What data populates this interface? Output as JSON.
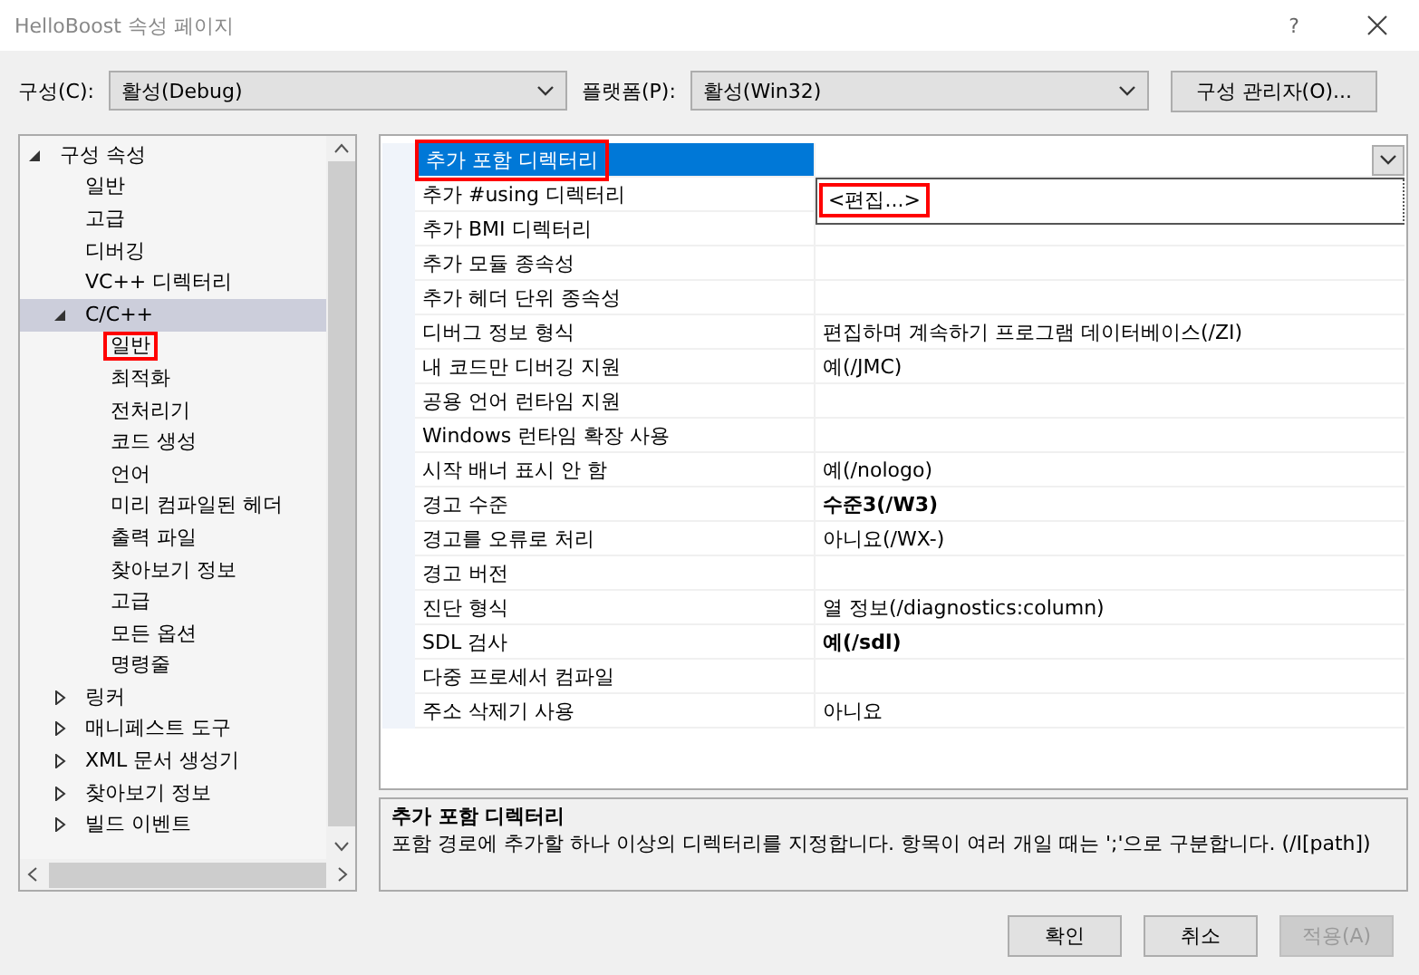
{
  "window": {
    "title": "HelloBoost 속성 페이지",
    "help": "?"
  },
  "toolbar": {
    "config_label": "구성(C):",
    "config_value": "활성(Debug)",
    "platform_label": "플랫폼(P):",
    "platform_value": "활성(Win32)",
    "manager_button": "구성 관리자(O)..."
  },
  "tree": [
    {
      "label": "구성 속성",
      "expanded": true,
      "selected": false,
      "annotated": false,
      "children": [
        {
          "label": "일반",
          "selected": false,
          "annotated": false
        },
        {
          "label": "고급",
          "selected": false,
          "annotated": false
        },
        {
          "label": "디버깅",
          "selected": false,
          "annotated": false
        },
        {
          "label": "VC++ 디렉터리",
          "selected": false,
          "annotated": false
        },
        {
          "label": "C/C++",
          "expanded": true,
          "selected": true,
          "annotated": false,
          "children": [
            {
              "label": "일반",
              "selected": false,
              "annotated": true
            },
            {
              "label": "최적화",
              "selected": false,
              "annotated": false
            },
            {
              "label": "전처리기",
              "selected": false,
              "annotated": false
            },
            {
              "label": "코드 생성",
              "selected": false,
              "annotated": false
            },
            {
              "label": "언어",
              "selected": false,
              "annotated": false
            },
            {
              "label": "미리 컴파일된 헤더",
              "selected": false,
              "annotated": false
            },
            {
              "label": "출력 파일",
              "selected": false,
              "annotated": false
            },
            {
              "label": "찾아보기 정보",
              "selected": false,
              "annotated": false
            },
            {
              "label": "고급",
              "selected": false,
              "annotated": false
            },
            {
              "label": "모든 옵션",
              "selected": false,
              "annotated": false
            },
            {
              "label": "명령줄",
              "selected": false,
              "annotated": false
            }
          ]
        },
        {
          "label": "링커",
          "expanded": false,
          "selected": false,
          "annotated": false
        },
        {
          "label": "매니페스트 도구",
          "expanded": false,
          "selected": false,
          "annotated": false
        },
        {
          "label": "XML 문서 생성기",
          "expanded": false,
          "selected": false,
          "annotated": false
        },
        {
          "label": "찾아보기 정보",
          "expanded": false,
          "selected": false,
          "annotated": false
        },
        {
          "label": "빌드 이벤트",
          "expanded": false,
          "selected": false,
          "annotated": false
        }
      ]
    }
  ],
  "grid": {
    "rows": [
      {
        "name": "추가 포함 디렉터리",
        "selected": true,
        "annotated": true,
        "dropdown_open": true
      },
      {
        "name": "추가 #using 디렉터리",
        "selected": false,
        "annotated": false
      },
      {
        "name": "추가 BMI 디렉터리",
        "selected": false,
        "annotated": false
      },
      {
        "name": "추가 모듈 종속성",
        "selected": false,
        "annotated": false
      },
      {
        "name": "추가 헤더 단위 종속성",
        "selected": false,
        "annotated": false
      },
      {
        "name": "디버그 정보 형식",
        "value": "편집하며 계속하기 프로그램 데이터베이스(/ZI)",
        "bold": false,
        "selected": false,
        "annotated": false
      },
      {
        "name": "내 코드만 디버깅 지원",
        "value": "예(/JMC)",
        "bold": false,
        "selected": false,
        "annotated": false
      },
      {
        "name": "공용 언어 런타임 지원",
        "selected": false,
        "annotated": false
      },
      {
        "name": "Windows 런타임 확장 사용",
        "selected": false,
        "annotated": false
      },
      {
        "name": "시작 배너 표시 안 함",
        "value": "예(/nologo)",
        "bold": false,
        "selected": false,
        "annotated": false
      },
      {
        "name": "경고 수준",
        "value": "수준3(/W3)",
        "bold": true,
        "selected": false,
        "annotated": false
      },
      {
        "name": "경고를 오류로 처리",
        "value": "아니요(/WX-)",
        "bold": false,
        "selected": false,
        "annotated": false
      },
      {
        "name": "경고 버전",
        "selected": false,
        "annotated": false
      },
      {
        "name": "진단 형식",
        "value": "열 정보(/diagnostics:column)",
        "bold": false,
        "selected": false,
        "annotated": false
      },
      {
        "name": "SDL 검사",
        "value": "예(/sdl)",
        "bold": true,
        "selected": false,
        "annotated": false
      },
      {
        "name": "다중 프로세서 컴파일",
        "selected": false,
        "annotated": false
      },
      {
        "name": "주소 삭제기 사용",
        "value": "아니요",
        "bold": false,
        "selected": false,
        "annotated": false
      }
    ],
    "dropdown_options": [
      {
        "label": "<편집...>",
        "annotated": true
      }
    ]
  },
  "description": {
    "title": "추가 포함 디렉터리",
    "text": "포함 경로에 추가할 하나 이상의 디렉터리를 지정합니다. 항목이 여러 개일 때는 ';'으로 구분합니다. (/I[path])"
  },
  "buttons": [
    {
      "label": "확인",
      "disabled": false
    },
    {
      "label": "취소",
      "disabled": false
    },
    {
      "label": "적용(A)",
      "disabled": true
    }
  ]
}
